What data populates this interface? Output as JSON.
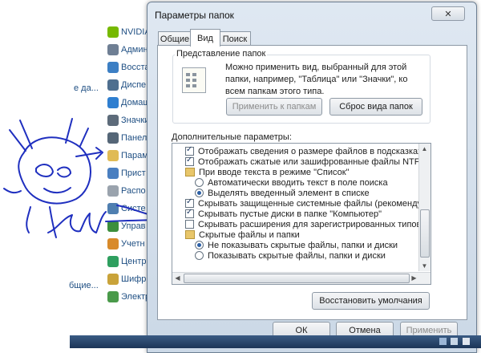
{
  "background": {
    "left_texts": [
      "е да...",
      "бщие..."
    ],
    "items": [
      {
        "label": "NVIDIA",
        "color": "#76b900"
      },
      {
        "label": "Админ",
        "color": "#6f7f94"
      },
      {
        "label": "Восста",
        "color": "#3c7fc4"
      },
      {
        "label": "Диспе",
        "color": "#4f6f8f"
      },
      {
        "label": "Домаш",
        "color": "#2f7fd0"
      },
      {
        "label": "Значки",
        "color": "#5d6b7a"
      },
      {
        "label": "Панел",
        "color": "#556677"
      },
      {
        "label": "Парам",
        "color": "#e0bb55"
      },
      {
        "label": "Прист",
        "color": "#4a7fc0"
      },
      {
        "label": "Распо",
        "color": "#9aa3ad"
      },
      {
        "label": "Систе",
        "color": "#4f7fb0"
      },
      {
        "label": "Управ",
        "color": "#3c8f3c"
      },
      {
        "label": "Учетн",
        "color": "#d88a2a"
      },
      {
        "label": "Центр",
        "color": "#2f9f5f"
      },
      {
        "label": "Шифр",
        "color": "#c9a33a"
      },
      {
        "label": "Электр",
        "color": "#4a9a4a"
      }
    ]
  },
  "dialog": {
    "title": "Параметры папок",
    "close_icon": "close-icon",
    "tabs": [
      "Общие",
      "Вид",
      "Поиск"
    ],
    "active_tab": "Вид",
    "folder_view": {
      "group_label": "Представление папок",
      "description": [
        "Можно применить вид, выбранный для этой",
        "папки, например, \"Таблица\" или \"Значки\", ко",
        "всем папкам этого типа."
      ],
      "apply_button": "Применить к папкам",
      "reset_button": "Сброс вида папок"
    },
    "advanced": {
      "label": "Дополнительные параметры:",
      "rows": [
        {
          "kind": "checkbox",
          "checked": true,
          "text": "Отображать сведения о размере файлов в подсказках п"
        },
        {
          "kind": "checkbox",
          "checked": true,
          "text": "Отображать сжатые или зашифрованные файлы NTFS др"
        },
        {
          "kind": "folder",
          "text": "При вводе текста в режиме \"Список\""
        },
        {
          "kind": "radio",
          "checked": false,
          "text": "Автоматически вводить текст в поле поиска"
        },
        {
          "kind": "radio",
          "checked": true,
          "text": "Выделять введенный элемент в списке"
        },
        {
          "kind": "checkbox",
          "checked": true,
          "text": "Скрывать защищенные системные файлы (рекомендуетс"
        },
        {
          "kind": "checkbox",
          "checked": true,
          "text": "Скрывать пустые диски в папке \"Компьютер\""
        },
        {
          "kind": "checkbox",
          "checked": false,
          "text": "Скрывать расширения для зарегистрированных типов ф"
        },
        {
          "kind": "folder",
          "text": "Скрытые файлы и папки"
        },
        {
          "kind": "radio",
          "checked": true,
          "text": "Не показывать скрытые файлы, папки и диски"
        },
        {
          "kind": "radio",
          "checked": false,
          "text": "Показывать скрытые файлы, папки и диски"
        }
      ]
    },
    "restore_button": "Восстановить умолчания",
    "ok_button": "ОК",
    "cancel_button": "Отмена",
    "apply_button": "Применить"
  }
}
